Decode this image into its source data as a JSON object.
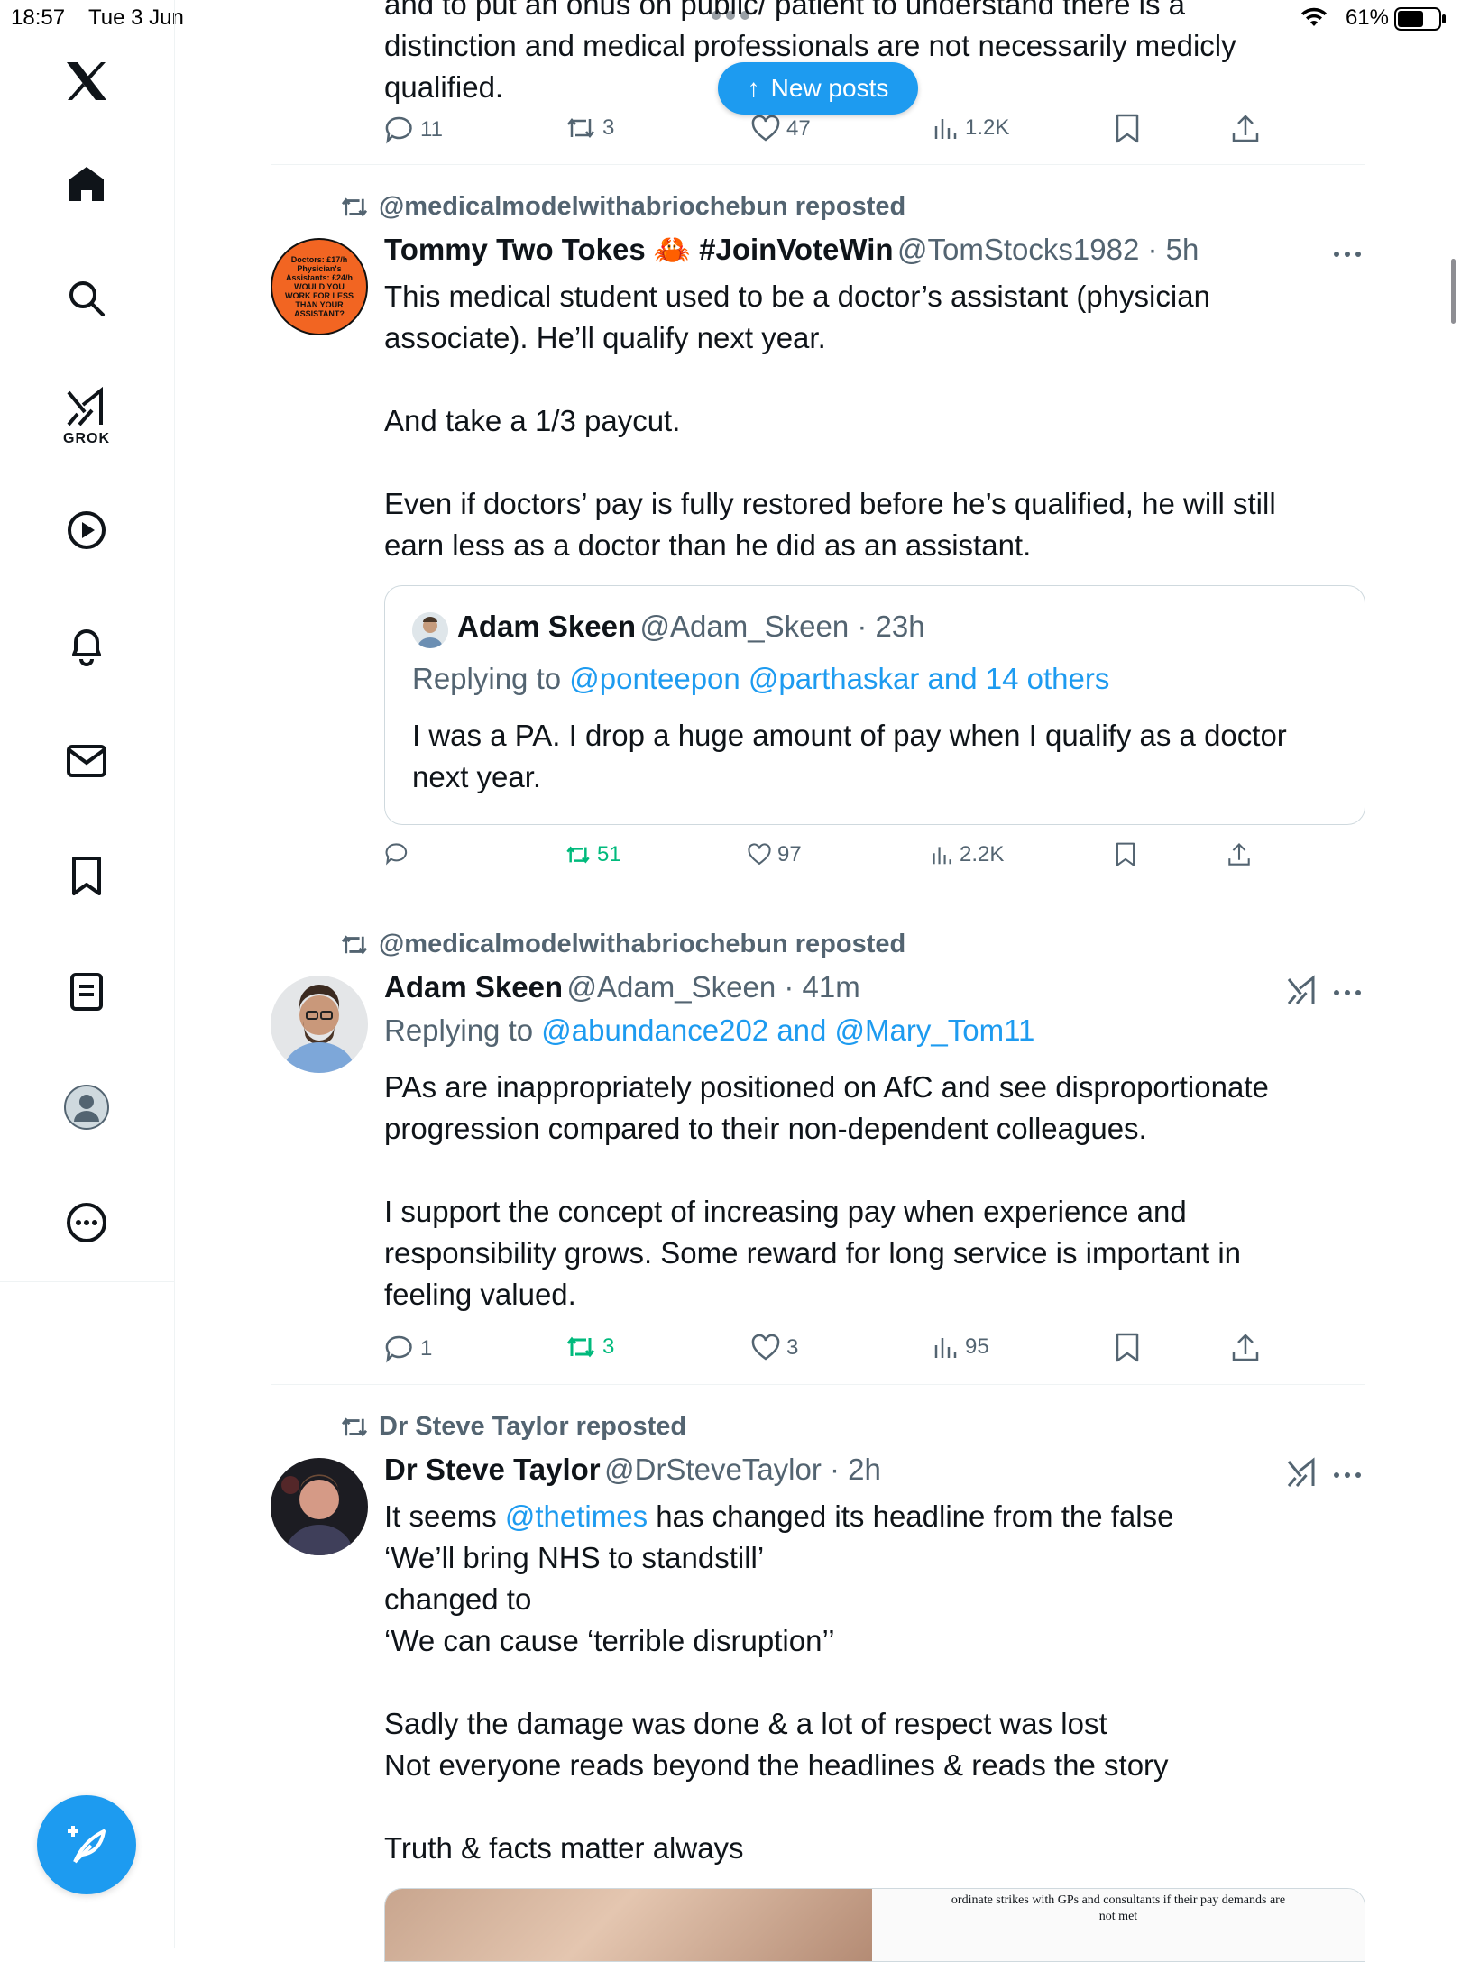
{
  "status": {
    "time": "18:57",
    "date": "Tue 3 Jun",
    "battery": "61%"
  },
  "sidebar": {
    "grok_label": "GROK"
  },
  "pill": {
    "label": "New posts"
  },
  "post0": {
    "text": "and to put an onus on public/ patient to understand there is a\ndistinction and medical professionals are not necessarily medicly\nqualified.",
    "replies": "11",
    "reposts": "3",
    "likes": "47",
    "views": "1.2K"
  },
  "post1": {
    "repost_by": "@medicalmodelwithabriochebun reposted",
    "name": "Tommy Two Tokes 🦀 #JoinVoteWin",
    "handle": "@TomStocks1982 · 5h",
    "avatar_text": "Doctors: £17/h\nPhysician's Assistants: £24/h\nWOULD YOU WORK FOR LESS THAN YOUR ASSISTANT?",
    "text": "This medical student used to be a doctor’s assistant (physician\nassociate). He’ll qualify next year.\n\nAnd take a 1/3 paycut.\n\nEven if doctors’ pay is fully restored before he’s qualified, he will still\nearn less as a doctor than he did as an assistant.",
    "quote": {
      "name": "Adam Skeen",
      "handle": "@Adam_Skeen · 23h",
      "replying_prefix": "Replying to ",
      "replying_links": "@ponteepon @parthaskar and 14 others",
      "text": "I was a PA. I drop a huge amount of pay when I qualify as a doctor\nnext year."
    },
    "replies": "",
    "reposts": "51",
    "likes": "97",
    "views": "2.2K"
  },
  "post2": {
    "repost_by": "@medicalmodelwithabriochebun reposted",
    "name": "Adam Skeen",
    "handle": "@Adam_Skeen · 41m",
    "replying_prefix": "Replying to ",
    "replying_links": "@abundance202 and @Mary_Tom11",
    "text": "PAs are inappropriately positioned on AfC and see disproportionate\nprogression compared to their non-dependent colleagues.\n\nI support the concept of increasing pay when experience and\nresponsibility grows. Some reward for long service is important in\nfeeling valued.",
    "replies": "1",
    "reposts": "3",
    "likes": "3",
    "views": "95"
  },
  "post3": {
    "repost_by": "Dr Steve Taylor reposted",
    "name": "Dr Steve Taylor",
    "handle": "@DrSteveTaylor · 2h",
    "text_before": "It seems ",
    "mention": "@thetimes",
    "text_after": " has changed its headline from the false\n‘We’ll bring NHS to standstill’\nchanged to\n‘We can cause ‘terrible disruption’’\n\nSadly the damage was done & a lot of respect was lost\nNot everyone reads beyond the headlines & reads the story\n\nTruth & facts matter always",
    "media_caption": "ordinate strikes with GPs and consultants if their pay demands are\nnot met"
  },
  "colors": {
    "accent": "#1d9bf0",
    "repost_green": "#00ba7c",
    "muted": "#536471"
  }
}
